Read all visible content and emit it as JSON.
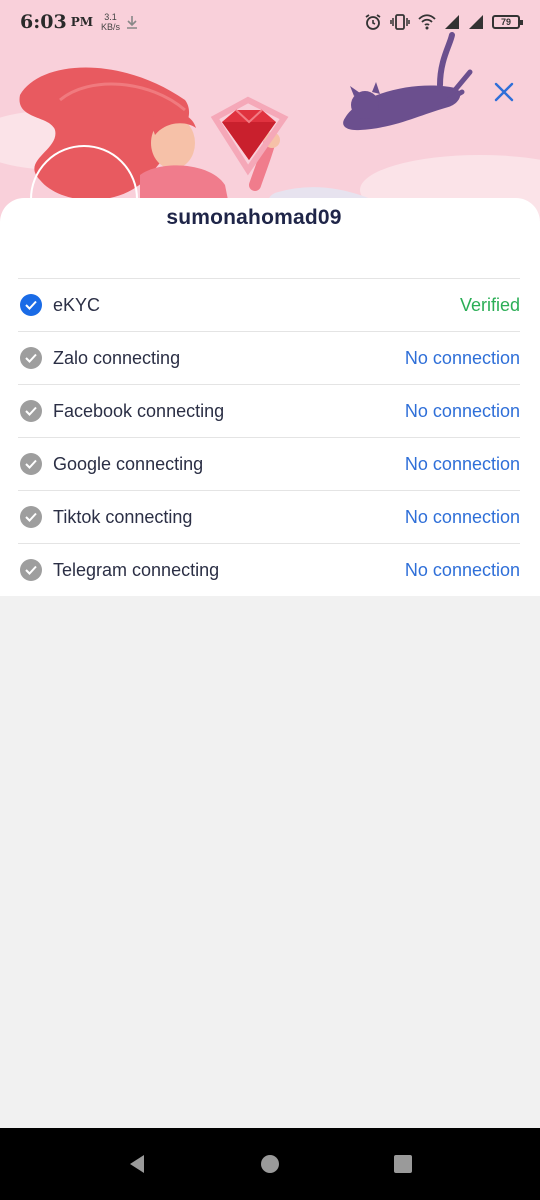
{
  "status_bar": {
    "time": "6:03",
    "ampm": "PM",
    "speed_value": "3.1",
    "speed_unit": "KB/s",
    "battery": "79"
  },
  "profile": {
    "username": "sumonahomad09"
  },
  "colors": {
    "banner": "#f9d0da",
    "verified": "#2bae56",
    "link": "#2f6fd8",
    "checked": "#1a6be6",
    "unchecked": "#9e9e9e"
  },
  "connections": [
    {
      "label": "eKYC",
      "status": "Verified",
      "verified": true
    },
    {
      "label": "Zalo connecting",
      "status": "No connection",
      "verified": false
    },
    {
      "label": "Facebook connecting",
      "status": "No connection",
      "verified": false
    },
    {
      "label": "Google connecting",
      "status": "No connection",
      "verified": false
    },
    {
      "label": "Tiktok connecting",
      "status": "No connection",
      "verified": false
    },
    {
      "label": "Telegram connecting",
      "status": "No connection",
      "verified": false
    }
  ]
}
